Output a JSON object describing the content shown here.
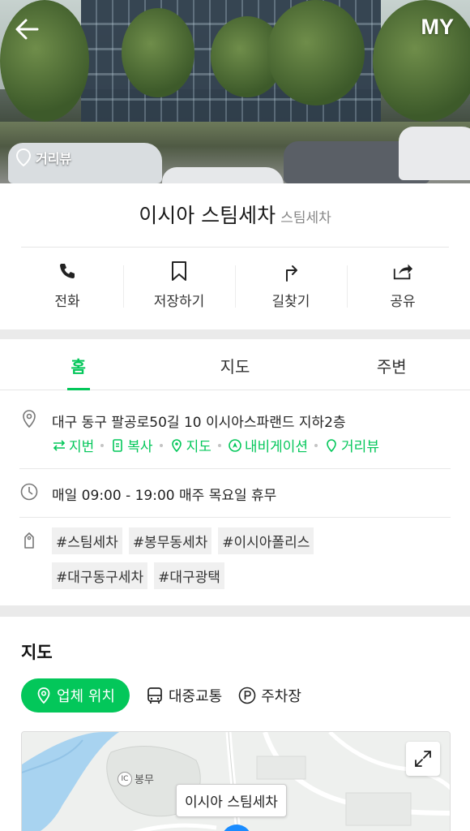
{
  "header": {
    "back_icon": "arrow-left-icon",
    "my_label": "MY",
    "streetview_badge": "거리뷰"
  },
  "place": {
    "name": "이시아 스팀세차",
    "category": "스팀세차"
  },
  "actions": [
    {
      "label": "전화",
      "icon": "phone-icon"
    },
    {
      "label": "저장하기",
      "icon": "bookmark-icon"
    },
    {
      "label": "길찾기",
      "icon": "directions-icon"
    },
    {
      "label": "공유",
      "icon": "share-icon"
    }
  ],
  "tabs": [
    {
      "label": "홈",
      "active": true
    },
    {
      "label": "지도",
      "active": false
    },
    {
      "label": "주변",
      "active": false
    }
  ],
  "info": {
    "address": "대구 동구 팔공로50길 10 이시아스파랜드 지하2층",
    "address_links": [
      "지번",
      "복사",
      "지도",
      "내비게이션",
      "거리뷰"
    ],
    "hours": "매일 09:00 - 19:00 매주 목요일 휴무",
    "tags": [
      "#스팀세차",
      "#봉무동세차",
      "#이시아폴리스",
      "#대구동구세차",
      "#대구광택"
    ]
  },
  "map_section": {
    "title": "지도",
    "chips": [
      {
        "label": "업체 위치",
        "active": true
      },
      {
        "label": "대중교통",
        "active": false
      },
      {
        "label": "주차장",
        "active": false
      }
    ],
    "ic_label": "봉무",
    "ic_badge": "IC",
    "marker_label": "이시아 스팀세차"
  },
  "colors": {
    "accent": "#03c75a",
    "pin": "#1a8cff"
  }
}
